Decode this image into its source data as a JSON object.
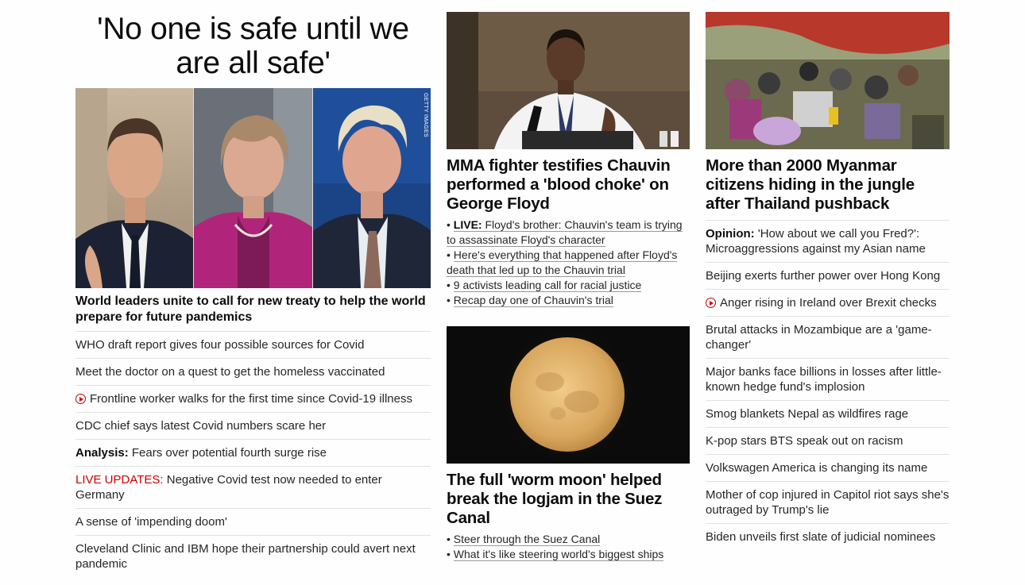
{
  "col1": {
    "banner": "'No one is safe until we are all safe'",
    "image_credit": "GETTY IMAGES",
    "headline": "World leaders unite to call for new treaty to help the world prepare for future pandemics",
    "items": [
      {
        "prefix": "",
        "text": "WHO draft report gives four possible sources for Covid"
      },
      {
        "prefix": "",
        "text": "Meet the doctor on a quest to get the homeless vaccinated"
      },
      {
        "prefix": "",
        "text": "Frontline worker walks for the first time since Covid-19 illness"
      },
      {
        "prefix": "",
        "text": "CDC chief says latest Covid numbers scare her"
      },
      {
        "prefix": "Analysis:",
        "text": " Fears over potential fourth surge rise"
      },
      {
        "prefix": "LIVE UPDATES:",
        "text": " Negative Covid test now needed to enter Germany"
      },
      {
        "prefix": "",
        "text": "A sense of 'impending doom'"
      },
      {
        "prefix": "",
        "text": "Cleveland Clinic and IBM hope their partnership could avert next pandemic"
      }
    ]
  },
  "col2": {
    "story1": {
      "headline": "MMA fighter testifies Chauvin performed a 'blood choke' on George Floyd",
      "bullets": [
        {
          "prefix": "LIVE:",
          "text": "Floyd's brother: Chauvin's team is trying to assassinate Floyd's character"
        },
        {
          "prefix": "",
          "text": "Here's everything that happened after Floyd's death that led up to the Chauvin trial"
        },
        {
          "prefix": "",
          "text": "9 activists leading call for racial justice"
        },
        {
          "prefix": "",
          "text": "Recap day one of Chauvin's trial"
        }
      ]
    },
    "story2": {
      "headline": "The full 'worm moon' helped break the logjam in the Suez Canal",
      "bullets": [
        {
          "prefix": "",
          "text": "Steer through the Suez Canal"
        },
        {
          "prefix": "",
          "text": "What it's like steering world's biggest ships"
        }
      ]
    }
  },
  "col3": {
    "headline": "More than 2000 Myanmar citizens hiding in the jungle after Thailand pushback",
    "items": [
      {
        "prefix": "Opinion:",
        "text": " 'How about we call you Fred?': Microaggressions against my Asian name"
      },
      {
        "prefix": "",
        "text": "Beijing exerts further power over Hong Kong"
      },
      {
        "prefix": "",
        "text": "Anger rising in Ireland over Brexit checks"
      },
      {
        "prefix": "",
        "text": "Brutal attacks in Mozambique are a 'game-changer'"
      },
      {
        "prefix": "",
        "text": "Major banks face billions in losses after little-known hedge fund's implosion"
      },
      {
        "prefix": "",
        "text": "Smog blankets Nepal as wildfires rage"
      },
      {
        "prefix": "",
        "text": "K-pop stars BTS speak out on racism"
      },
      {
        "prefix": "",
        "text": "Volkswagen America is changing its name"
      },
      {
        "prefix": "",
        "text": "Mother of cop injured in Capitol riot says she's outraged by Trump's lie"
      },
      {
        "prefix": "",
        "text": "Biden unveils first slate of judicial nominees"
      }
    ]
  },
  "colors": {
    "accent_red": "#cc0000",
    "text": "#262626",
    "divider": "#e1e1e1"
  }
}
